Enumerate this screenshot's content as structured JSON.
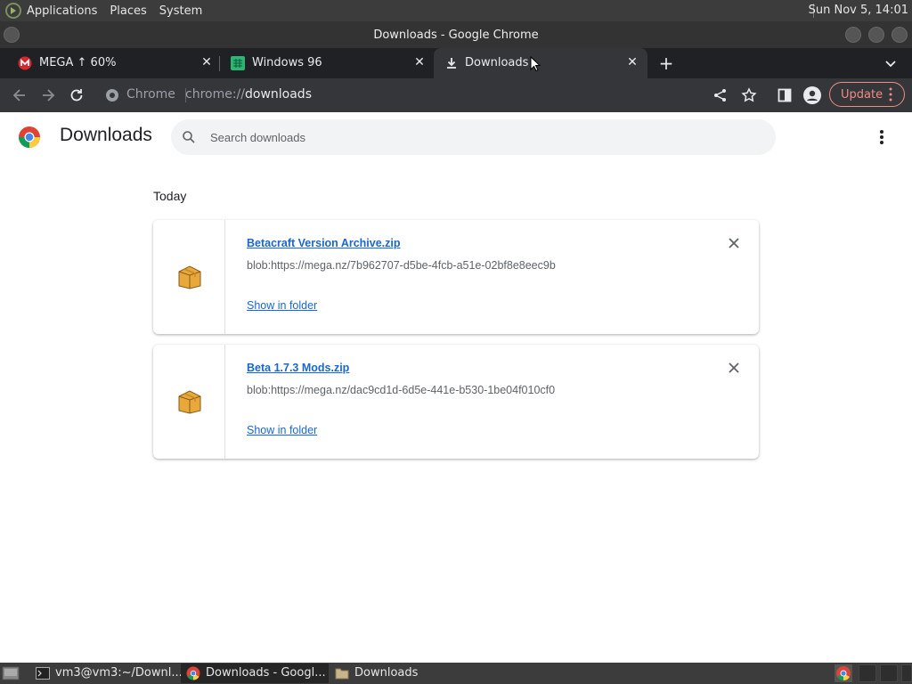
{
  "system_panel": {
    "menus": [
      "Applications",
      "Places",
      "System"
    ],
    "clock": "Sun Nov  5, 14:01"
  },
  "window": {
    "title": "Downloads - Google Chrome"
  },
  "tabs": [
    {
      "label": "MEGA ↑ 60%",
      "icon": "mega-icon"
    },
    {
      "label": "Windows 96",
      "icon": "windows96-icon"
    },
    {
      "label": "Downloads",
      "icon": "download-icon"
    }
  ],
  "toolbar": {
    "site_label": "Chrome",
    "url_scheme": "chrome://",
    "url_host": "downloads",
    "update_label": "Update"
  },
  "page": {
    "title": "Downloads",
    "search_placeholder": "Search downloads",
    "section_date": "Today",
    "items": [
      {
        "filename": "Betacraft Version Archive.zip",
        "url": "blob:https://mega.nz/7b962707-d5be-4fcb-a51e-02bf8e8eec9b",
        "action": "Show in folder"
      },
      {
        "filename": "Beta 1.7.3 Mods.zip",
        "url": "blob:https://mega.nz/dac9cd1d-6d5e-441e-b530-1be04f010cf0",
        "action": "Show in folder"
      }
    ]
  },
  "taskbar": {
    "tasks": [
      {
        "label": "vm3@vm3:~/Downl...",
        "icon": "terminal-icon"
      },
      {
        "label": "Downloads - Googl...",
        "icon": "chrome-icon"
      },
      {
        "label": "Downloads",
        "icon": "folder-icon"
      }
    ]
  },
  "colors": {
    "link": "#1967d2",
    "update_accent": "#f28b82",
    "tab_bg": "#202124",
    "toolbar_bg": "#35363a"
  }
}
